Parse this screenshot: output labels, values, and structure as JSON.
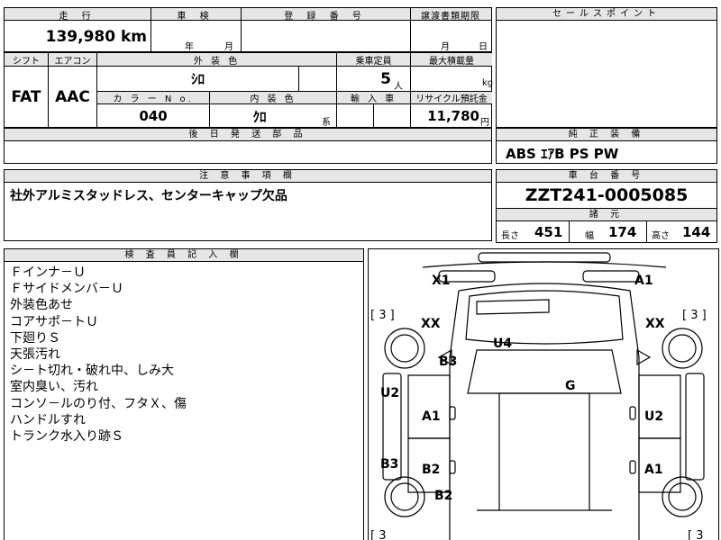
{
  "top": {
    "headers": {
      "mileage": "走 行",
      "inspection": "車 検",
      "registration": "登 録 番 号",
      "transfer_deadline": "譲渡書類期限",
      "sales_point": "セールスポイント"
    },
    "mileage_value": "139,980 km",
    "inspection_year_unit": "年",
    "inspection_month_unit": "月",
    "transfer_month_unit": "月",
    "transfer_day_unit": "日"
  },
  "specs": {
    "shift_label": "シフト",
    "ac_label": "エアコン",
    "exterior_color_label": "外 装 色",
    "capacity_label": "乗車定員",
    "max_load_label": "最大積載量",
    "shift_value": "FAT",
    "ac_value": "AAC",
    "exterior_color_value": "ｼﾛ",
    "capacity_value": "5",
    "capacity_unit": "人",
    "max_load_unit": "kg",
    "color_no_label": "カ ラ ー N o.",
    "interior_color_label": "内 装 色",
    "import_label": "輸 入 車",
    "recycle_label": "リサイクル預託金",
    "color_no_value": "040",
    "interior_color_value": "ｸﾛ",
    "interior_color_unit": "系",
    "recycle_value": "11,780",
    "recycle_unit": "円",
    "later_parts_label": "後 日 発 送 部 品"
  },
  "equipment": {
    "label": "純 正 装 備",
    "value": "ABS ｴｱB PS PW"
  },
  "notes": {
    "label": "注 意 事 項 欄",
    "value": "社外アルミスタッドレス、センターキャップ欠品"
  },
  "chassis": {
    "label": "車 台 番 号",
    "value": "ZZT241-0005085",
    "dims_label": "諸 元",
    "length_label": "長さ",
    "length_value": "451",
    "width_label": "幅",
    "width_value": "174",
    "height_label": "高さ",
    "height_value": "144"
  },
  "inspector": {
    "label": "検 査 員 記 入 欄",
    "lines": [
      "Ｆインナ－Ｕ",
      "Ｆサイドメンバ－Ｕ",
      "外装色あせ",
      "コアサポ－トＵ",
      "下廻りＳ",
      "天張汚れ",
      "シ－ト切れ・破れ中、しみ大",
      "室内臭い、汚れ",
      "コンソ－ルのり付、フタＸ、傷",
      "ハンドルすれ",
      "トランク水入り跡Ｓ"
    ]
  },
  "diagram": {
    "marks": {
      "front_left_corner": "X1",
      "front_right_corner": "A1",
      "left_front_wheel": "XX",
      "right_front_wheel": "XX",
      "hood": "U4",
      "left_front_fender": "B3",
      "windshield": "G",
      "left_front_pillar": "U2",
      "right_front_pillar": "U2",
      "left_front_door": "A1",
      "left_rear_door": "B2",
      "right_rear_door": "A1",
      "left_sill": "B3",
      "left_rear_fender": "B2"
    },
    "tire_tl": "[ 3 ]",
    "tire_tr": "[ 3 ]",
    "tire_bl": "[ 3",
    "tire_br": "[ 3"
  }
}
